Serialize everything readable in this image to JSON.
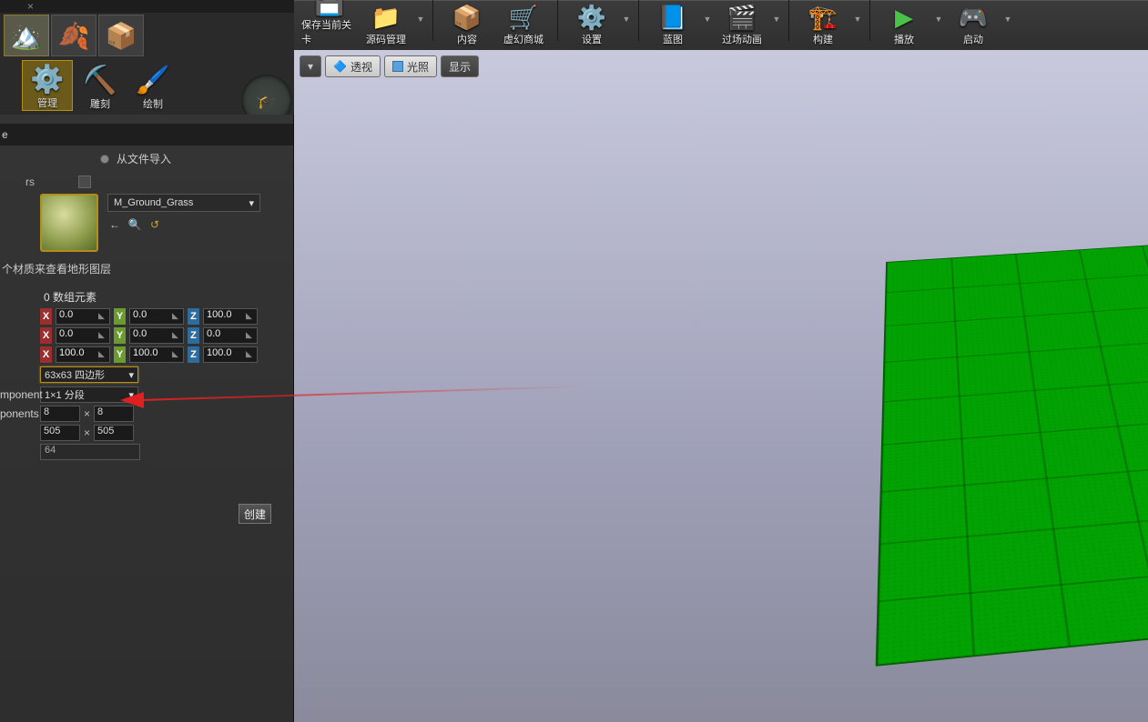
{
  "toolbar": {
    "save": "保存当前关卡",
    "source": "源码管理",
    "content": "内容",
    "marketplace": "虚幻商城",
    "settings": "设置",
    "blueprint": "蓝图",
    "cinematic": "过场动画",
    "build": "构建",
    "play": "播放",
    "launch": "启动"
  },
  "mode_tabs": {
    "manage": "管理",
    "sculpt": "雕刻",
    "paint": "绘制"
  },
  "panel": {
    "header_e": "e",
    "import_label": "从文件导入",
    "layers_label": "rs",
    "material_name": "M_Ground_Grass",
    "material_info": "个材质来查看地形图层",
    "array_count": "0 数组元素",
    "row1": {
      "x": "0.0",
      "y": "0.0",
      "z": "100.0"
    },
    "row2": {
      "x": "0.0",
      "y": "0.0",
      "z": "0.0"
    },
    "row3": {
      "x": "100.0",
      "y": "100.0",
      "z": "100.0"
    },
    "section_size": "63x63 四边形",
    "segments": "1×1 分段",
    "component_label": "mponent",
    "components_label": "ponents",
    "comps_x": "8",
    "comps_y": "8",
    "res_x": "505",
    "res_y": "505",
    "total": "64",
    "create": "创建"
  },
  "viewport": {
    "perspective": "透视",
    "lighting": "光照",
    "show": "显示"
  }
}
